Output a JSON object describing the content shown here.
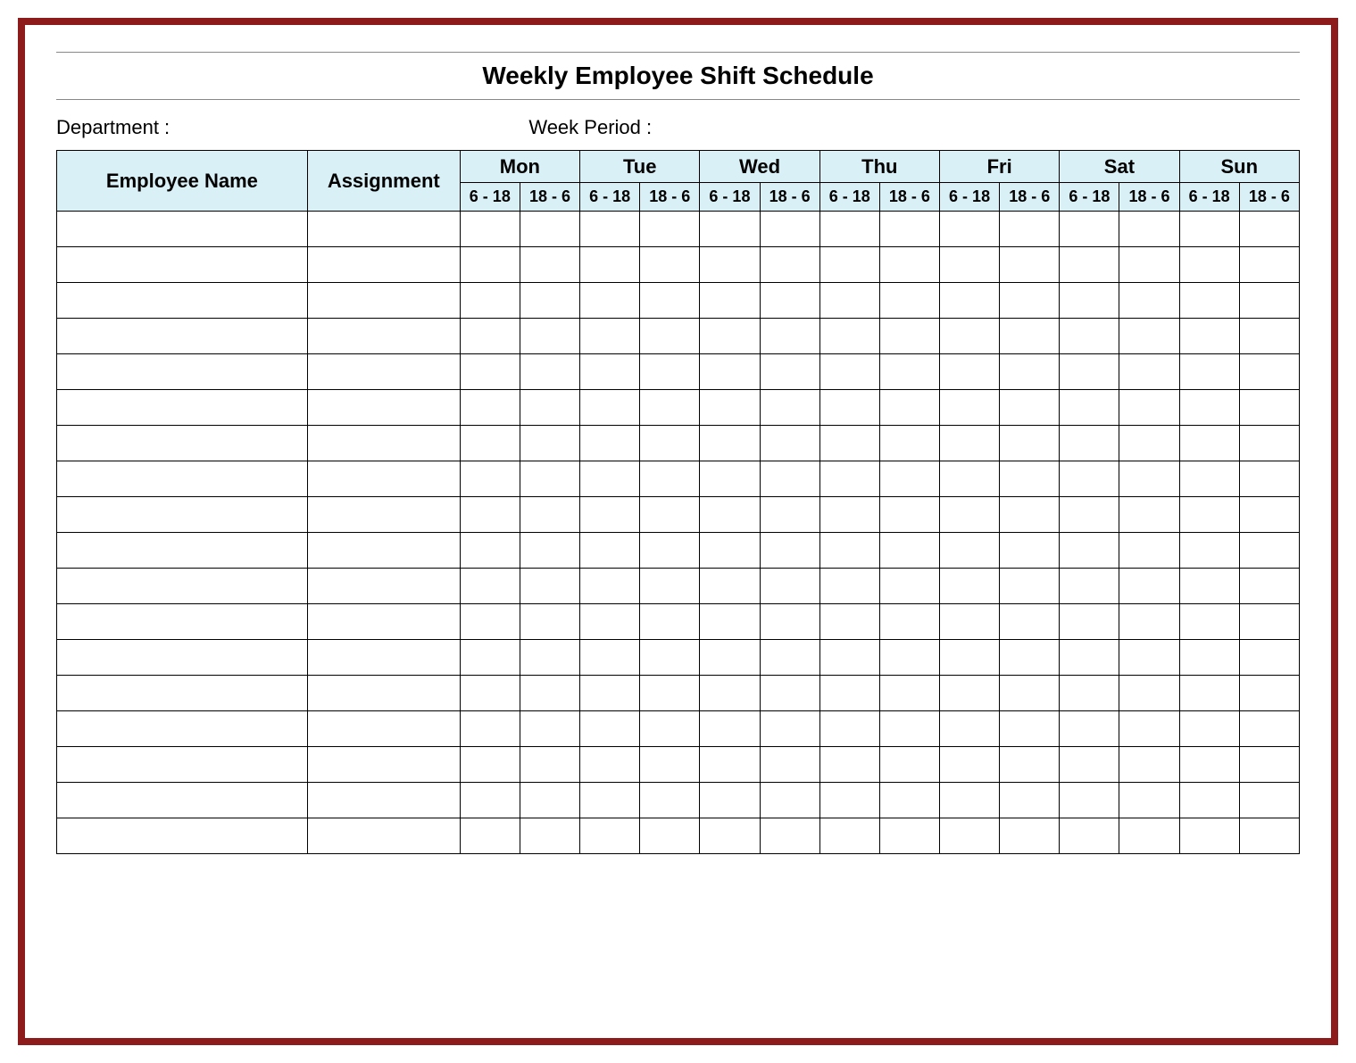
{
  "title": "Weekly Employee Shift Schedule",
  "meta": {
    "department_label": "Department :",
    "week_period_label": "Week  Period :"
  },
  "columns": {
    "employee": "Employee Name",
    "assignment": "Assignment"
  },
  "days": [
    "Mon",
    "Tue",
    "Wed",
    "Thu",
    "Fri",
    "Sat",
    "Sun"
  ],
  "shifts": [
    "6 - 18",
    "18 - 6"
  ],
  "row_count": 18,
  "colors": {
    "frame_border": "#8d1b1b",
    "header_fill": "#d9f0f7"
  }
}
